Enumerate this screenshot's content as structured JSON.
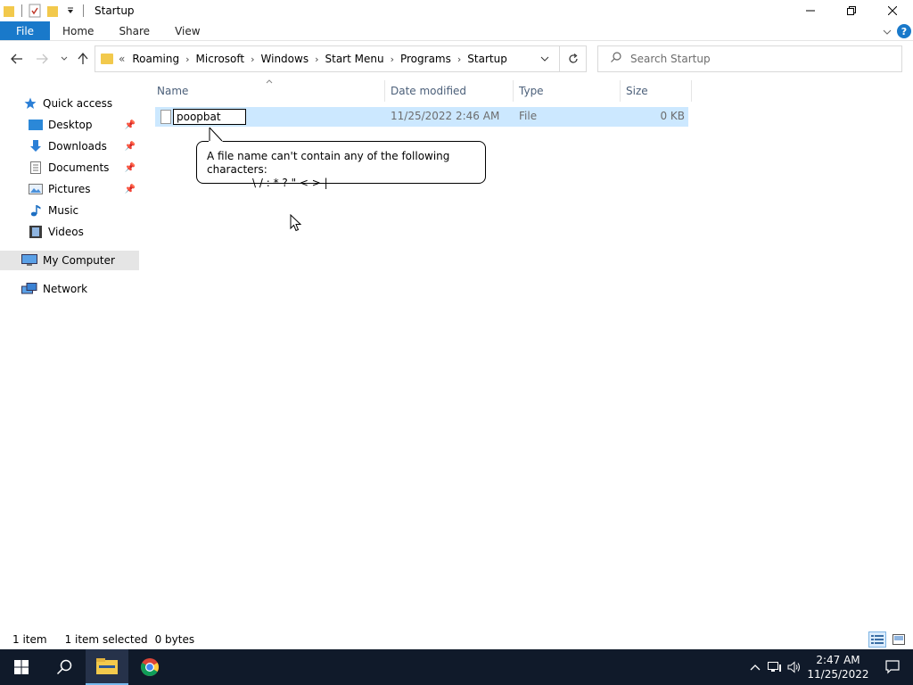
{
  "window": {
    "title": "Startup"
  },
  "ribbon": {
    "file_tab": "File",
    "tabs": [
      "Home",
      "Share",
      "View"
    ],
    "help": "?"
  },
  "address": {
    "prefix": "«",
    "crumbs": [
      "Roaming",
      "Microsoft",
      "Windows",
      "Start Menu",
      "Programs",
      "Startup"
    ]
  },
  "search": {
    "placeholder": "Search Startup"
  },
  "nav": {
    "quick_access": "Quick access",
    "items": [
      "Desktop",
      "Downloads",
      "Documents",
      "Pictures",
      "Music",
      "Videos"
    ],
    "my_computer": "My Computer",
    "network": "Network"
  },
  "columns": {
    "name": "Name",
    "date": "Date modified",
    "type": "Type",
    "size": "Size"
  },
  "file": {
    "name": "poopbat",
    "date": "11/25/2022 2:46 AM",
    "type": "File",
    "size": "0 KB"
  },
  "tooltip": {
    "line1": "A file name can't contain any of the following characters:",
    "line2": "\\ / : * ? \" < > |"
  },
  "status": {
    "count": "1 item",
    "selected": "1 item selected",
    "bytes": "0 bytes"
  },
  "clock": {
    "time": "2:47 AM",
    "date": "11/25/2022"
  },
  "colors": {
    "file_tab": "#1979ca",
    "selection": "#cce8ff",
    "taskbar": "#101a2a"
  }
}
